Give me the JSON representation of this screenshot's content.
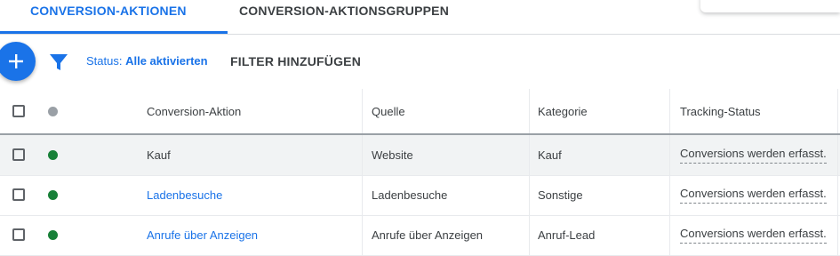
{
  "tabs": [
    {
      "label": "CONVERSION-AKTIONEN",
      "active": true
    },
    {
      "label": "CONVERSION-AKTIONSGRUPPEN",
      "active": false
    }
  ],
  "toolbar": {
    "status_label": "Status:",
    "status_value": "Alle aktivierten",
    "add_filter_label": "FILTER HINZUFÜGEN"
  },
  "table": {
    "columns": [
      "Conversion-Aktion",
      "Quelle",
      "Kategorie",
      "Tracking-Status"
    ],
    "rows": [
      {
        "name": "Kauf",
        "source": "Website",
        "category": "Kauf",
        "tracking": "Conversions werden erfasst.",
        "highlighted": true
      },
      {
        "name": "Ladenbesuche",
        "source": "Ladenbesuche",
        "category": "Sonstige",
        "tracking": "Conversions werden erfasst."
      },
      {
        "name": "Anrufe über Anzeigen",
        "source": "Anrufe über Anzeigen",
        "category": "Anruf-Lead",
        "tracking": "Conversions werden erfasst."
      }
    ]
  },
  "colors": {
    "accent": "#1a73e8",
    "status_enabled": "#188038",
    "status_header": "#9aa0a6",
    "highlight": "#f7f52f"
  }
}
